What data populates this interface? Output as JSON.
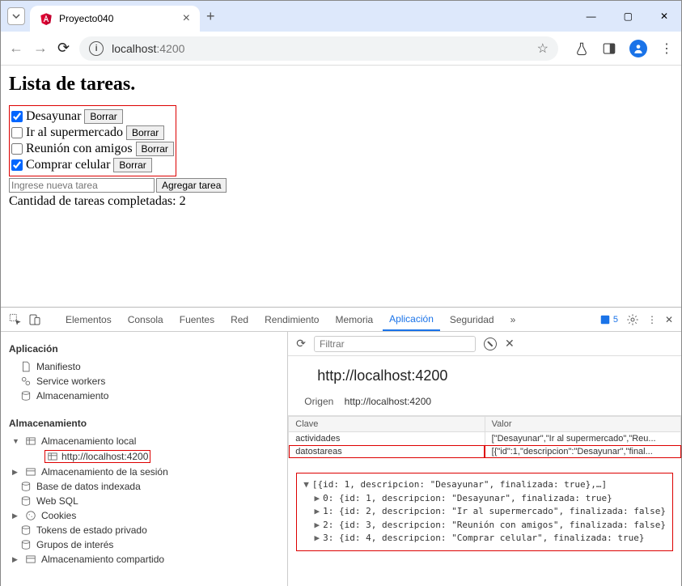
{
  "browser": {
    "tab_title": "Proyecto040",
    "url_host": "localhost",
    "url_port": ":4200"
  },
  "page": {
    "heading": "Lista de tareas.",
    "delete_label": "Borrar",
    "add_placeholder": "Ingrese nueva tarea",
    "add_button": "Agregar tarea",
    "count_prefix": "Cantidad de tareas completadas: ",
    "count_value": "2",
    "tasks": [
      {
        "label": "Desayunar",
        "checked": true
      },
      {
        "label": "Ir al supermercado",
        "checked": false
      },
      {
        "label": "Reunión con amigos",
        "checked": false
      },
      {
        "label": "Comprar celular",
        "checked": true
      }
    ]
  },
  "devtools": {
    "tabs": [
      "Elementos",
      "Consola",
      "Fuentes",
      "Red",
      "Rendimiento",
      "Memoria",
      "Aplicación",
      "Seguridad"
    ],
    "active_tab": "Aplicación",
    "issue_count": "5",
    "filter_placeholder": "Filtrar",
    "sidebar": {
      "section1": "Aplicación",
      "items1": [
        "Manifiesto",
        "Service workers",
        "Almacenamiento"
      ],
      "section2": "Almacenamiento",
      "local_storage": "Almacenamiento local",
      "local_storage_origin": "http://localhost:4200",
      "items2": [
        "Almacenamiento de la sesión",
        "Base de datos indexada",
        "Web SQL",
        "Cookies",
        "Tokens de estado privado",
        "Grupos de interés",
        "Almacenamiento compartido"
      ]
    },
    "main": {
      "origin_title": "http://localhost:4200",
      "origin_label": "Origen",
      "origin_value": "http://localhost:4200",
      "col_key": "Clave",
      "col_value": "Valor",
      "rows": [
        {
          "k": "actividades",
          "v": "[\"Desayunar\",\"Ir al supermercado\",\"Reu..."
        },
        {
          "k": "datostareas",
          "v": "[{\"id\":1,\"descripcion\":\"Desayunar\",\"final..."
        }
      ],
      "preview": {
        "head": "[{id: 1, descripcion: \"Desayunar\", finalizada: true},…]",
        "lines": [
          "0: {id: 1, descripcion: \"Desayunar\", finalizada: true}",
          "1: {id: 2, descripcion: \"Ir al supermercado\", finalizada: false}",
          "2: {id: 3, descripcion: \"Reunión con amigos\", finalizada: false}",
          "3: {id: 4, descripcion: \"Comprar celular\", finalizada: true}"
        ]
      }
    }
  }
}
